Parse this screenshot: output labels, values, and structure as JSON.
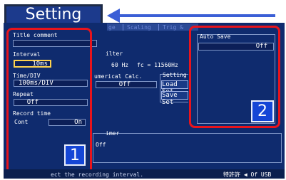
{
  "header": {
    "title": "Setting"
  },
  "tabs": [
    "ge",
    "Scaling",
    "Trig &"
  ],
  "left_panel": {
    "title_comment_label": "Title comment",
    "interval_label": "Interval",
    "interval_value": "10ms",
    "time_div_label": "Time/DIV",
    "time_div_value": "100ms/DIV",
    "repeat_label": "Repeat",
    "repeat_value": "Off",
    "record_time_label": "Record time",
    "record_time_mode": "Cont",
    "record_time_value": "On"
  },
  "center_panel": {
    "filter_label": "ilter",
    "filter_value": "60 Hz",
    "fc_text": "fc = 11560Hz",
    "numerical_label": "umerical Calc.",
    "numerical_value": "Off",
    "setting_label": "Setting",
    "load_button": "Load Set",
    "save_button": "Save Set",
    "timer_label": "imer",
    "timer_value": "Off"
  },
  "right_panel": {
    "auto_save_label": "Auto Save",
    "auto_save_value": "Off"
  },
  "badges": {
    "one": "1",
    "two": "2"
  },
  "status_bar": {
    "message": "ect the recording interval.",
    "indicator": "特許許 ◀ Of USB"
  },
  "colors": {
    "screen_bg": "#0f2b6e",
    "highlight": "#e8141c",
    "arrow": "#3b5fd6",
    "badge": "#1546d6"
  }
}
